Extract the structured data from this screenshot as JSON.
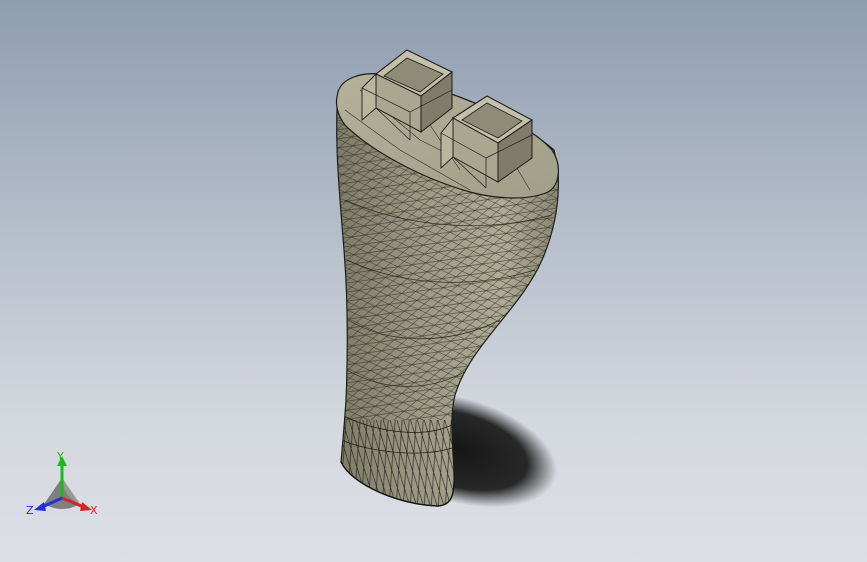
{
  "viewport": {
    "background_top": "#8f9db1",
    "background_bottom": "#dcdfe4"
  },
  "model": {
    "face_color": "#a3a18a",
    "edge_color": "#2b2b24",
    "shadow_color": "#111111"
  },
  "triad": {
    "icon": "axis-triad-icon",
    "x_label": "X",
    "y_label": "Y",
    "z_label": "Z",
    "x_color": "#d92323",
    "y_color": "#1fb81f",
    "z_color": "#2330d9"
  }
}
